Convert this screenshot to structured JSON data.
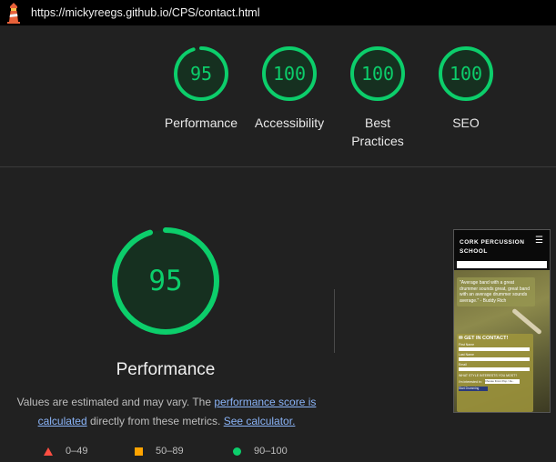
{
  "url": "https://mickyreegs.github.io/CPS/contact.html",
  "colors": {
    "pass": "#0cce6b",
    "average": "#ffa400",
    "fail": "#ff4e42",
    "link": "#8ab4f8"
  },
  "scores": [
    {
      "name": "Performance",
      "value": "95",
      "fraction": 0.95
    },
    {
      "name": "Accessibility",
      "value": "100",
      "fraction": 1.0
    },
    {
      "name": "Best Practices",
      "value": "100",
      "fraction": 1.0
    },
    {
      "name": "SEO",
      "value": "100",
      "fraction": 1.0
    }
  ],
  "main": {
    "score": "95",
    "fraction": 0.95,
    "title": "Performance",
    "desc_prefix": "Values are estimated and may vary. The ",
    "desc_link1": "performance score is calculated",
    "desc_middle": " directly from these metrics. ",
    "desc_link2": "See calculator."
  },
  "legend": [
    {
      "icon": "triangle-icon",
      "label": "0–49"
    },
    {
      "icon": "square-icon",
      "label": "50–89"
    },
    {
      "icon": "circle-icon",
      "label": "90–100"
    }
  ],
  "thumbnail": {
    "brand": "CORK PERCUSSION SCHOOL",
    "menu": "☰",
    "quote": "\"Average band with a great drummer sounds great, great band with an average drummer sounds average.\" - Buddy Rich",
    "form_title": "GET IN CONTACT!",
    "field1": "First Name",
    "field2": "Last Name",
    "field3": "Email",
    "question": "WHAT STYLE INTERESTS YOU MOST?",
    "select_label": "I'm interested in:",
    "select_value": "Choose From Pop / Ja...",
    "button": "Start Drumming"
  }
}
